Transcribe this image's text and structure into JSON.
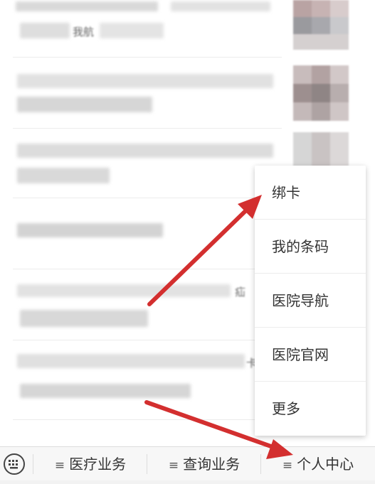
{
  "feed": {
    "fragments": [
      "我航",
      "疝",
      "卡"
    ]
  },
  "menu": {
    "items": [
      {
        "label": "绑卡"
      },
      {
        "label": "我的条码"
      },
      {
        "label": "医院导航"
      },
      {
        "label": "医院官网"
      },
      {
        "label": "更多"
      }
    ]
  },
  "bottom_nav": {
    "keyboard_icon": "keyboard-icon",
    "tabs": [
      {
        "label": "医疗业务",
        "icon": "menu-lines-icon"
      },
      {
        "label": "查询业务",
        "icon": "menu-lines-icon"
      },
      {
        "label": "个人中心",
        "icon": "menu-lines-icon"
      }
    ]
  },
  "colors": {
    "annotation_arrow": "#d32f2f",
    "menu_background": "#ffffff",
    "bar_background": "#f7f7f7"
  }
}
